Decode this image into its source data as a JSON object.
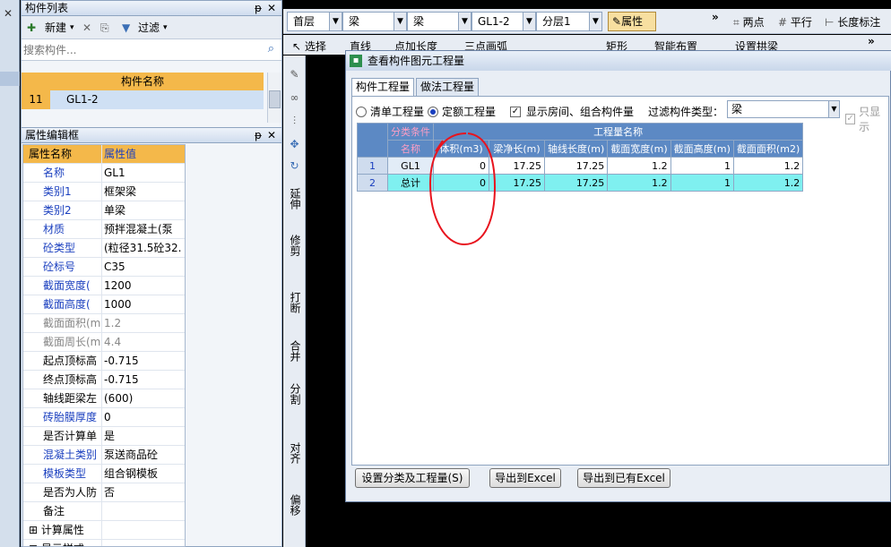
{
  "left_panel": {
    "close_glyph": "✕",
    "component_list_title": "构件列表",
    "pin_glyph": "ᵽ",
    "close_x": "✕",
    "new_label": "新建",
    "filter_label": "过滤",
    "search_placeholder": "搜索构件...",
    "list_header": "构件名称",
    "list_rows": [
      {
        "index": "11",
        "name": "GL1-2"
      }
    ],
    "props_title": "属性编辑框",
    "props_header_name": "属性名称",
    "props_header_value": "属性值",
    "props": [
      {
        "name": "名称",
        "value": "GL1",
        "style": "blue"
      },
      {
        "name": "类别1",
        "value": "框架梁",
        "style": "blue"
      },
      {
        "name": "类别2",
        "value": "单梁",
        "style": "blue"
      },
      {
        "name": "材质",
        "value": "预拌混凝土(泵",
        "style": "blue"
      },
      {
        "name": "砼类型",
        "value": "(粒径31.5砼32.",
        "style": "blue"
      },
      {
        "name": "砼标号",
        "value": "C35",
        "style": "blue"
      },
      {
        "name": "截面宽度(",
        "value": "1200",
        "style": "blue"
      },
      {
        "name": "截面高度(",
        "value": "1000",
        "style": "blue"
      },
      {
        "name": "截面面积(m",
        "value": "1.2",
        "style": "gray"
      },
      {
        "name": "截面周长(m",
        "value": "4.4",
        "style": "gray"
      },
      {
        "name": "起点顶标高",
        "value": "-0.715",
        "style": "normal"
      },
      {
        "name": "终点顶标高",
        "value": "-0.715",
        "style": "normal"
      },
      {
        "name": "轴线距梁左",
        "value": "(600)",
        "style": "normal"
      },
      {
        "name": "砖胎膜厚度",
        "value": "0",
        "style": "blue"
      },
      {
        "name": "是否计算单",
        "value": "是",
        "style": "normal"
      },
      {
        "name": "混凝土类别",
        "value": "泵送商品砼",
        "style": "blue"
      },
      {
        "name": "模板类型",
        "value": "组合钢模板",
        "style": "blue"
      },
      {
        "name": "是否为人防",
        "value": "否",
        "style": "normal"
      },
      {
        "name": "备注",
        "value": "",
        "style": "normal"
      },
      {
        "name": "计算属性",
        "value": "",
        "style": "group"
      },
      {
        "name": "显示样式",
        "value": "",
        "style": "group"
      }
    ]
  },
  "toolbar": {
    "floor": "首层",
    "type1": "梁",
    "type2": "梁",
    "component": "GL1-2",
    "layer": "分层1",
    "props_button": "属性",
    "two_points": "两点",
    "parallel": "平行",
    "length_mark": "长度标注",
    "select": "选择",
    "line": "直线",
    "point_length": "点加长度",
    "three_arc": "三点画弧",
    "rect": "矩形",
    "smart_layout": "智能布置",
    "set_arch": "设置拱梁",
    "more": "»"
  },
  "vertical_tools": [
    "延伸",
    "修剪",
    "打断",
    "合并",
    "分割",
    "对齐",
    "偏移"
  ],
  "dialog": {
    "title": "查看构件图元工程量",
    "tab1": "构件工程量",
    "tab2": "做法工程量",
    "radio1": "清单工程量",
    "radio2": "定额工程量",
    "check_label": "显示房间、组合构件量",
    "filter_label": "过滤构件类型：",
    "filter_value": "梁",
    "only_show": "只显示",
    "table": {
      "cat_header": "分类条件",
      "name_header": "名称",
      "qty_header": "工程量名称",
      "columns": [
        "体积(m3)",
        "梁净长(m)",
        "轴线长度(m)",
        "截面宽度(m)",
        "截面高度(m)",
        "截面面积(m2)"
      ],
      "rows": [
        {
          "idx": "1",
          "name": "GL1",
          "cells": [
            "0",
            "17.25",
            "17.25",
            "1.2",
            "1",
            "1.2"
          ]
        },
        {
          "idx": "2",
          "name": "总计",
          "cells": [
            "0",
            "17.25",
            "17.25",
            "1.2",
            "1",
            "1.2"
          ]
        }
      ]
    },
    "btn_setup": "设置分类及工程量(S)",
    "btn_export": "导出到Excel",
    "btn_export_existing": "导出到已有Excel"
  },
  "colors": {
    "header_blue": "#5c89c4",
    "total_row": "#7ff0f0",
    "annotation_red": "#e8141e"
  }
}
